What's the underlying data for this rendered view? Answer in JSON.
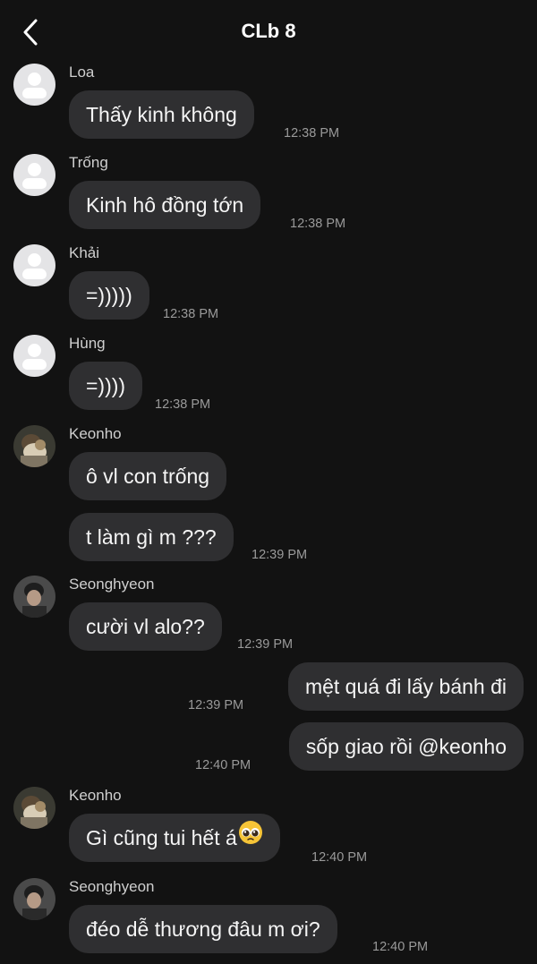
{
  "header": {
    "title": "CLb 8",
    "back_icon": "chevron-left-icon"
  },
  "messages": [
    {
      "sender": "Loa",
      "avatar": "default",
      "text": "Thấy kinh không",
      "time": "12:38 PM"
    },
    {
      "sender": "Trống",
      "avatar": "default",
      "text": "Kinh hô đồng tớn",
      "time": "12:38 PM"
    },
    {
      "sender": "Khải",
      "avatar": "default",
      "text": "=)))))",
      "time": "12:38 PM"
    },
    {
      "sender": "Hùng",
      "avatar": "default",
      "text": "=))))",
      "time": "12:38 PM"
    },
    {
      "sender": "Keonho",
      "avatar": "photo",
      "text": "ô vl con trống",
      "time": ""
    },
    {
      "sender": "",
      "avatar": "none",
      "text": "t làm gì m ???",
      "time": "12:39 PM"
    },
    {
      "sender": "Seonghyeon",
      "avatar": "photo",
      "text": "cười vl alo??",
      "time": "12:39 PM"
    },
    {
      "sender": "me",
      "avatar": "none",
      "text": "mệt quá đi lấy bánh đi",
      "time": "12:39 PM"
    },
    {
      "sender": "me",
      "avatar": "none",
      "text": "sốp giao rồi @keonho",
      "time": "12:40 PM"
    },
    {
      "sender": "Keonho",
      "avatar": "photo",
      "text": "Gì cũng tui hết á",
      "emoji": "pleading-face-emoji",
      "time": "12:40 PM"
    },
    {
      "sender": "Seonghyeon",
      "avatar": "photo",
      "text": "đéo dễ thương đâu m ơi?",
      "time": "12:40 PM"
    }
  ],
  "colors": {
    "background": "#121212",
    "bubble": "#2f2f31",
    "text": "#f5f5f5",
    "timestamp": "#9a9a9a",
    "sender": "#cfcfcf",
    "default_avatar": "#e4e4e6"
  }
}
